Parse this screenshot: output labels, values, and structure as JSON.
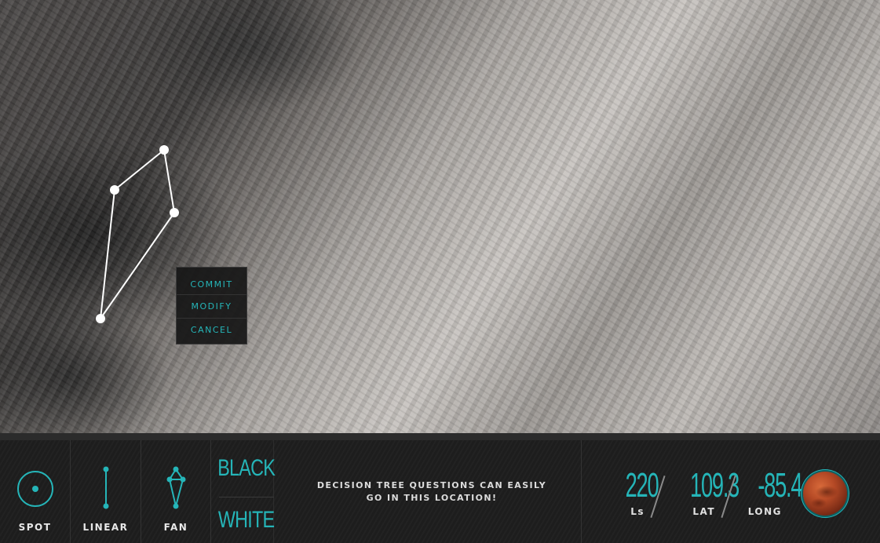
{
  "context_menu": {
    "items": [
      {
        "label": "COMMIT"
      },
      {
        "label": "MODIFY"
      },
      {
        "label": "CANCEL"
      }
    ]
  },
  "toolbar": {
    "tools": [
      {
        "label": "SPOT",
        "icon": "spot-icon"
      },
      {
        "label": "LINEAR",
        "icon": "linear-icon"
      },
      {
        "label": "FAN",
        "icon": "fan-icon"
      }
    ],
    "modes": {
      "black": "BLACK",
      "white": "WHITE"
    },
    "message": "DECISION TREE QUESTIONS CAN EASILY GO IN THIS LOCATION!"
  },
  "coordinates": {
    "ls": {
      "value": "220",
      "label": "Ls"
    },
    "lat": {
      "value": "109.3",
      "label": "LAT"
    },
    "long": {
      "value": "-85.4",
      "label": "LONG"
    }
  },
  "colors": {
    "accent": "#25b5b8",
    "bar": "#1f1f1f"
  }
}
